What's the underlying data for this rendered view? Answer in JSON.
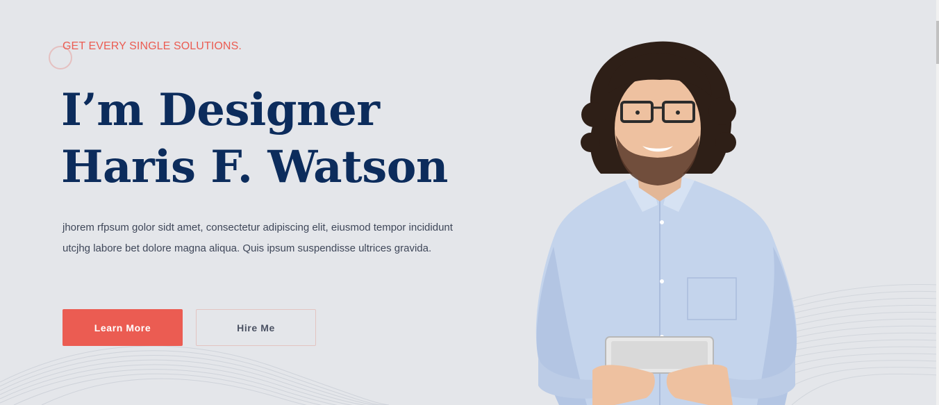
{
  "hero": {
    "tagline": "GET EVERY SINGLE SOLUTIONS.",
    "headline_line1": "I’m Designer",
    "headline_line2": "Haris F. Watson",
    "description": "jhorem rfpsum golor sidt amet, consectetur adipiscing elit, eiusmod tempor incididunt utcjhg labore bet dolore magna aliqua. Quis ipsum suspendisse ultrices gravida.",
    "primary_button": "Learn More",
    "secondary_button": "Hire Me"
  },
  "colors": {
    "background": "#e4e6ea",
    "accent": "#eb5c52",
    "heading": "#0c2c5c",
    "body_text": "#3f4759"
  },
  "icons": {
    "decorative_circle": "ring-outline",
    "portrait": "person-with-tablet"
  }
}
